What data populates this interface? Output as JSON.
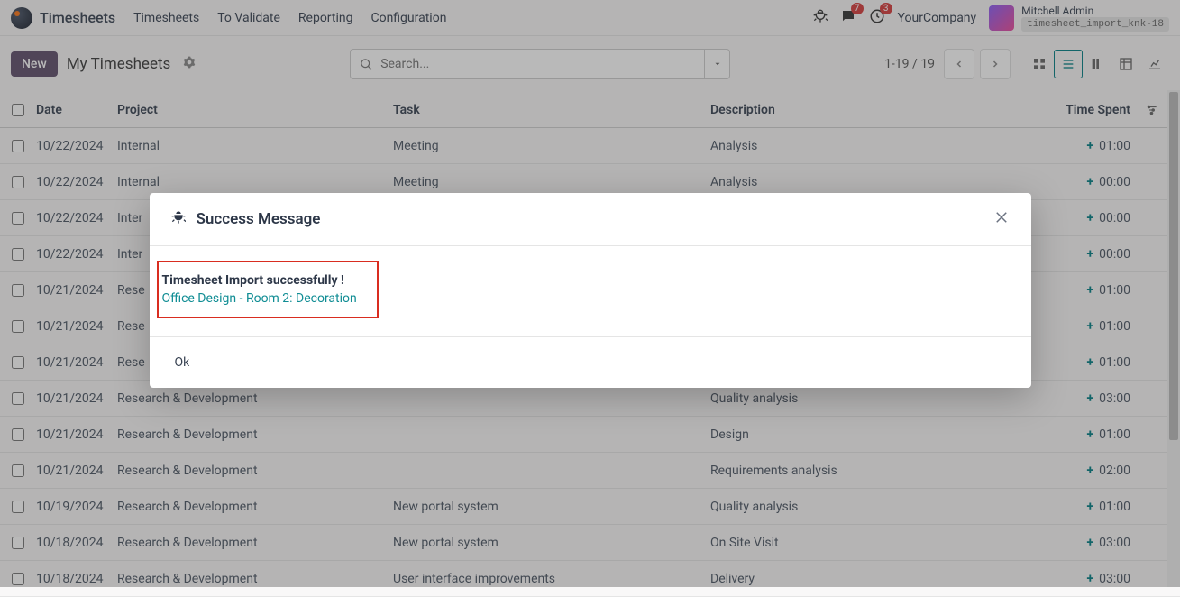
{
  "app_title": "Timesheets",
  "nav": [
    "Timesheets",
    "To Validate",
    "Reporting",
    "Configuration"
  ],
  "right": {
    "chat_badge": "7",
    "cal_badge": "3",
    "company": "YourCompany",
    "user": "Mitchell Admin",
    "db": "timesheet_import_knk-18"
  },
  "cp": {
    "new": "New",
    "title": "My Timesheets",
    "search_placeholder": "Search...",
    "pager": "1-19 / 19"
  },
  "cols": {
    "date": "Date",
    "project": "Project",
    "task": "Task",
    "desc": "Description",
    "time": "Time Spent"
  },
  "rows": [
    {
      "date": "10/22/2024",
      "project": "Internal",
      "task": "Meeting",
      "desc": "Analysis",
      "time": "01:00"
    },
    {
      "date": "10/22/2024",
      "project": "Internal",
      "task": "Meeting",
      "desc": "Analysis",
      "time": "00:00"
    },
    {
      "date": "10/22/2024",
      "project": "Inter",
      "task": "",
      "desc": "",
      "time": "00:00"
    },
    {
      "date": "10/22/2024",
      "project": "Inter",
      "task": "",
      "desc": "",
      "time": "00:00"
    },
    {
      "date": "10/21/2024",
      "project": "Rese",
      "task": "",
      "desc": "",
      "time": "01:00"
    },
    {
      "date": "10/21/2024",
      "project": "Rese",
      "task": "",
      "desc": "",
      "time": "01:00"
    },
    {
      "date": "10/21/2024",
      "project": "Rese",
      "task": "",
      "desc": "",
      "time": "01:00"
    },
    {
      "date": "10/21/2024",
      "project": "Research & Development",
      "task": "",
      "desc": "Quality analysis",
      "time": "03:00"
    },
    {
      "date": "10/21/2024",
      "project": "Research & Development",
      "task": "",
      "desc": "Design",
      "time": "01:00"
    },
    {
      "date": "10/21/2024",
      "project": "Research & Development",
      "task": "",
      "desc": "Requirements analysis",
      "time": "02:00"
    },
    {
      "date": "10/19/2024",
      "project": "Research & Development",
      "task": "New portal system",
      "desc": "Quality analysis",
      "time": "01:00"
    },
    {
      "date": "10/18/2024",
      "project": "Research & Development",
      "task": "New portal system",
      "desc": "On Site Visit",
      "time": "03:00"
    },
    {
      "date": "10/18/2024",
      "project": "Research & Development",
      "task": "User interface improvements",
      "desc": "Delivery",
      "time": "03:00"
    }
  ],
  "modal": {
    "title": "Success Message",
    "line1": "Timesheet Import successfully !",
    "line2": "Office Design - Room 2: Decoration",
    "ok": "Ok"
  }
}
